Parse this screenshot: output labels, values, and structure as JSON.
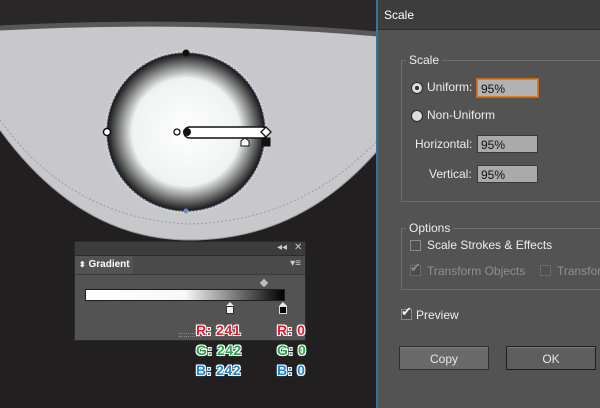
{
  "canvas": {
    "shape_colors": {
      "bowl_fill": "#c8c8ca",
      "bowl_stroke": "#8b8b8d",
      "top_band": "#9a9a9c",
      "background": "#221f21"
    }
  },
  "gradient_panel": {
    "collapse_icon": "double-chevron-left-icon",
    "close_icon": "close-icon",
    "tab_label": "Gradient",
    "menu_icon": "panel-menu-icon",
    "stops": [
      {
        "color": "#f1f2f2"
      },
      {
        "color": "#000000"
      }
    ]
  },
  "color_values": {
    "left": {
      "r": "R: 241",
      "g": "G: 242",
      "b": "B: 242"
    },
    "right": {
      "r": "R: 0",
      "g": "G: 0",
      "b": "B: 0"
    }
  },
  "dialog": {
    "title": "Scale",
    "scale_group": {
      "title": "Scale",
      "uniform_label": "Uniform:",
      "uniform_value": "95%",
      "non_uniform_label": "Non-Uniform",
      "horizontal_label": "Horizontal:",
      "horizontal_value": "95%",
      "vertical_label": "Vertical:",
      "vertical_value": "95%"
    },
    "options_group": {
      "title": "Options",
      "scale_strokes_label": "Scale Strokes & Effects",
      "transform_objects_label": "Transform Objects",
      "transform_patterns_label": "Transform"
    },
    "preview_label": "Preview",
    "copy_label": "Copy",
    "ok_label": "OK",
    "accent": "#e07d1a"
  }
}
